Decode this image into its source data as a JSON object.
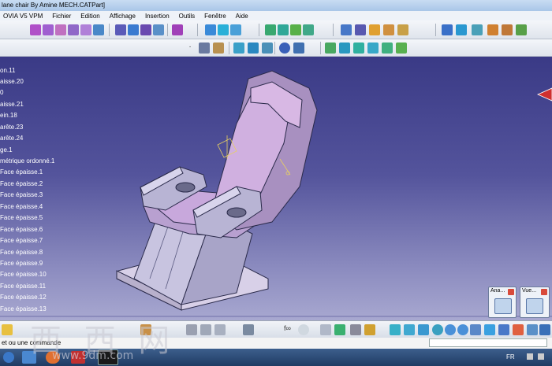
{
  "window": {
    "title": "lane chair By Amine MECH.CATPart]"
  },
  "menu": {
    "items": [
      "OVIA V5 VPM",
      "Fichier",
      "Edition",
      "Affichage",
      "Insertion",
      "Outils",
      "Fenêtre",
      "Aide"
    ]
  },
  "tree": {
    "items": [
      "on.11",
      "aisse.20",
      "0",
      "aisse.21",
      "ein.18",
      "arête.23",
      "arête.24",
      "ge.1",
      "métrique ordonné.1",
      "Face épaisse.1",
      "Face épaisse.2",
      "Face épaisse.3",
      "Face épaisse.4",
      "Face épaisse.5",
      "Face épaisse.6",
      "Face épaisse.7",
      "Face épaisse.8",
      "Face épaisse.9",
      "Face épaisse.10",
      "Face épaisse.11",
      "Face épaisse.12",
      "Face épaisse.13"
    ]
  },
  "status": {
    "prompt": "et ou une commande"
  },
  "mini_windows": {
    "analysis": "Ana...",
    "view": "Vue..."
  },
  "taskbar": {
    "lang": "FR"
  },
  "watermark": {
    "big": "西 西 网",
    "small": "www.9dm.com"
  },
  "colors": {
    "background_top": "#3a3a86",
    "background_bottom": "#a8a8d0",
    "part": "#c8a8d8",
    "part_dark": "#8a7aa8"
  }
}
